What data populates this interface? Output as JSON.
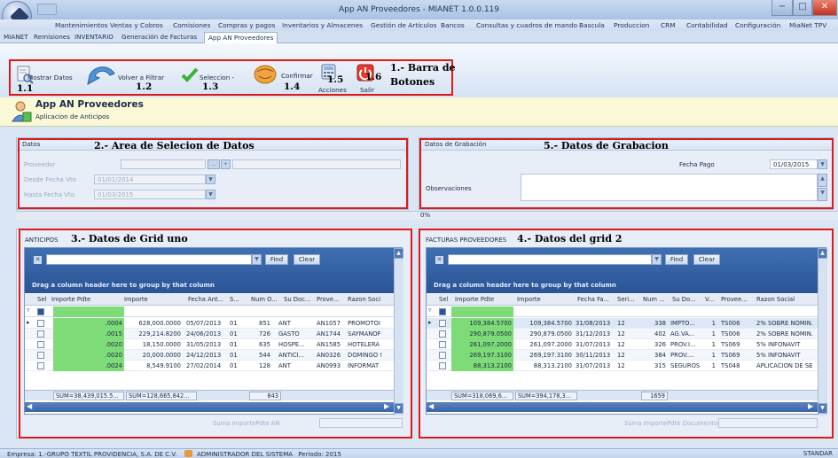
{
  "window": {
    "title": "App AN Proveedores - MIANET 1.0.0.119",
    "controls": [
      "−",
      "□",
      "✕"
    ]
  },
  "menu": [
    "Mantenimientos",
    "Ventas y Cobros",
    "Comisiones",
    "Compras y pagos",
    "Inventarios y Almacenes",
    "Gestión de Artículos",
    "Bancos",
    "Consultas y cuadros de mando",
    "Bascula",
    "Produccion",
    "CRM",
    "Contabilidad",
    "Configuración",
    "MiaNet TPV"
  ],
  "tabs": [
    "MIANET",
    "Remisiones",
    "INVENTARIO",
    "Generación de Facturas",
    "App AN Proveedores"
  ],
  "ribbon": {
    "mostrar": "Mostrar Datos",
    "volver": "Volver a Filtrar",
    "seleccion": "Seleccion -",
    "confirmar": "Confirmar",
    "acciones": "Acciones",
    "salir": "Salir",
    "n11": "1.1",
    "n12": "1.2",
    "n13": "1.3",
    "n14": "1.4",
    "n15": "1.5",
    "n16": "1.6",
    "anno_l1": "1.- Barra de",
    "anno_l2": "Botones"
  },
  "app": {
    "title": "App AN Proveedores",
    "subtitle": "Aplicacion de Anticipos"
  },
  "datos": {
    "head": "Datos",
    "anno": "2.- Area de Selecion de Datos",
    "proveedor_label": "Proveedor",
    "desde_label": "Desde Fecha Vto",
    "desde_value": "01/01/2014",
    "hasta_label": "Hasta Fecha Vto",
    "hasta_value": "01/03/2015",
    "button_label": "..."
  },
  "grabacion": {
    "head": "Datos de Grabación",
    "anno": "5.- Datos de Grabacion",
    "fecha_label": "Fecha Pago",
    "fecha_value": "01/03/2015",
    "obs_label": "Observaciones"
  },
  "progress": {
    "label": "0%",
    "value": 0
  },
  "grid1": {
    "head": "ANTICIPOS",
    "anno": "3.- Datos de Grid uno",
    "find": "Find",
    "clear": "Clear",
    "drag": "Drag a column header here to group by that column",
    "columns": [
      "Sel",
      "Importe Pdte",
      "Importe",
      "Fecha Ant...",
      "S...",
      "Num O...",
      "Su Doc...",
      "Prove...",
      "Razon Soci"
    ],
    "rows": [
      [
        ".0004",
        "628,000.0000",
        "05/07/2013",
        "01",
        "851",
        "ANT",
        "AN1057",
        "PROMOTOI"
      ],
      [
        ".0015",
        "229,214.8200",
        "24/06/2013",
        "01",
        "726",
        "GASTO",
        "AN1744",
        "SAYMANOF"
      ],
      [
        ".0020",
        "18,150.0000",
        "31/05/2013",
        "01",
        "635",
        "HOSPE...",
        "AN1585",
        "HOTELERA"
      ],
      [
        ".0020",
        "20,000.0000",
        "24/12/2013",
        "01",
        "544",
        "ANTICI...",
        "AN0326",
        "DOMINGO !"
      ],
      [
        ".0024",
        "8,549.9100",
        "27/02/2014",
        "01",
        "128",
        "ANT",
        "AN0993",
        "INFORMAT"
      ]
    ],
    "sum1": "SUM=38,439,015.5...",
    "sum2": "SUM=128,665,842...",
    "sum3": "843",
    "footer": "Suma ImportePdte AN"
  },
  "grid2": {
    "head": "FACTURAS PROVEEDORES",
    "anno": "4.- Datos del grid 2",
    "find": "Find",
    "clear": "Clear",
    "drag": "Drag a column header here to group by that column",
    "columns": [
      "Sel",
      "Importe Pdte",
      "Importe",
      "Fecha Fa...",
      "Seri...",
      "Num ...",
      "Su Do...",
      "V...",
      "Provee...",
      "Razon Social"
    ],
    "rows": [
      [
        "109,384.5700",
        "109,384.5700",
        "31/08/2013",
        "12",
        "338",
        "IMPTO...",
        "1",
        "TS006",
        "2% SOBRE NOMIN."
      ],
      [
        "290,879.0500",
        "290,879.0500",
        "31/12/2013",
        "12",
        "402",
        "AG.VA...",
        "1",
        "TS006",
        "2% SOBRE NOMIN."
      ],
      [
        "261,097.2000",
        "261,097.2000",
        "31/07/2013",
        "12",
        "326",
        "PROV.I...",
        "1",
        "TS069",
        "5% INFONAVIT"
      ],
      [
        "269,197.3100",
        "269,197.3100",
        "30/11/2013",
        "12",
        "384",
        "PROV....",
        "1",
        "TS069",
        "5% INFONAVIT"
      ],
      [
        "88,313.2100",
        "88,313.2100",
        "31/07/2013",
        "12",
        "315",
        "SEGUROS",
        "1",
        "TS048",
        "APLICACION DE SE"
      ]
    ],
    "sum1": "SUM=318,069,6...",
    "sum2": "SUM=394,178,3...",
    "sum3": "1659",
    "footer": "Suma ImportePdte Documentos"
  },
  "status": {
    "empresa": "Empresa: 1.-GRUPO TEXTIL PROVIDENCIA, S.A. DE C.V.",
    "usuario": "ADMINISTRADOR DEL SISTEMA",
    "periodo": "Periodo: 2015",
    "right": "STANDAR"
  }
}
